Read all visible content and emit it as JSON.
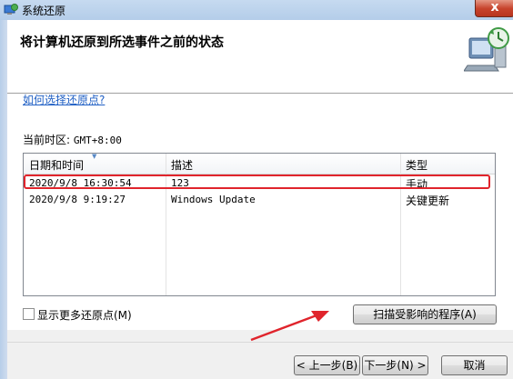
{
  "window": {
    "title": "系统还原",
    "close_label": "x"
  },
  "header": {
    "title": "将计算机还原到所选事件之前的状态"
  },
  "help_link": "如何选择还原点?",
  "timezone": {
    "label": "当前时区:",
    "value": "GMT+8:00"
  },
  "restore_list": {
    "columns": [
      "日期和时间",
      "描述",
      "类型"
    ],
    "rows": [
      {
        "datetime": "2020/9/8 16:30:54",
        "description": "123",
        "type": "手动"
      },
      {
        "datetime": "2020/9/8 9:19:27",
        "description": "Windows Update",
        "type": "关键更新"
      }
    ],
    "highlight_color": "#e0242c"
  },
  "show_more_checkbox": {
    "label": "显示更多还原点(M)",
    "checked": false
  },
  "buttons": {
    "scan": "扫描受影响的程序(A)",
    "prev": "< 上一步(B)",
    "next": "下一步(N) >",
    "cancel": "取消"
  },
  "colors": {
    "link": "#1f5fc4",
    "annotation_arrow": "#e0242c"
  },
  "icons": {
    "title": "restore-icon",
    "hero": "computer-restore-icon"
  }
}
